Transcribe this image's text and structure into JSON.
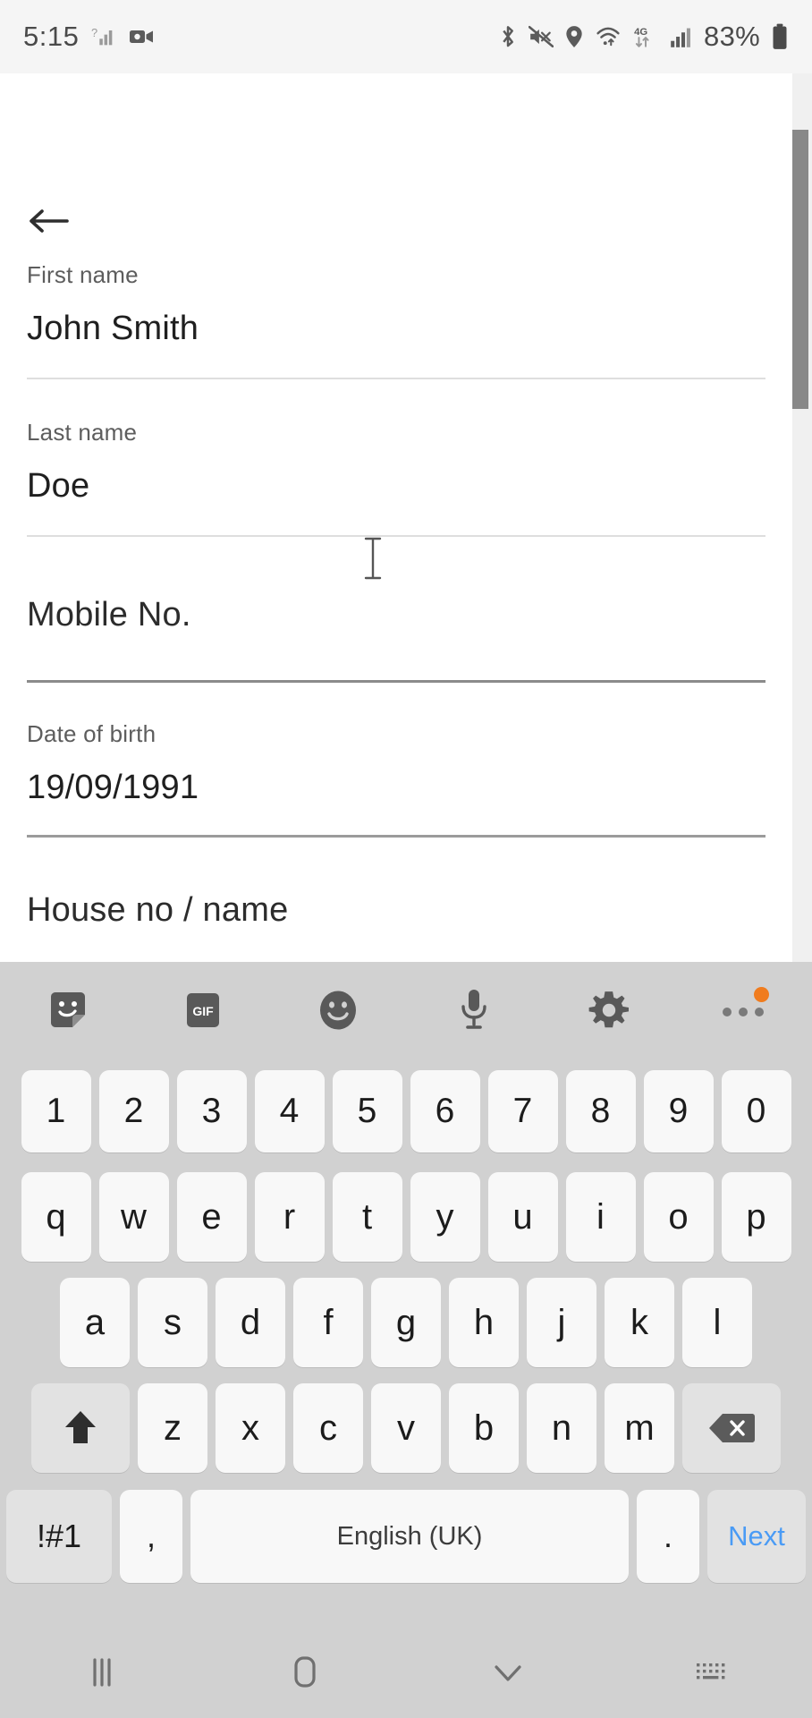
{
  "status_bar": {
    "time": "5:15",
    "battery_percent": "83%",
    "left_icons": [
      "signal-unknown-icon",
      "video-camera-icon"
    ],
    "right_icons": [
      "bluetooth-icon",
      "mute-icon",
      "location-icon",
      "wifi-icon",
      "4g-icon",
      "cellular-signal-icon"
    ],
    "network_label": "4G",
    "colors": {
      "background": "#f5f5f5",
      "foreground": "#4a4a4a"
    }
  },
  "content": {
    "back_icon": "back-arrow-icon",
    "fields": [
      {
        "label": "First name",
        "value": "John Smith",
        "placeholder": "",
        "focused": false
      },
      {
        "label": "Last name",
        "value": "Doe",
        "placeholder": "",
        "focused": false
      },
      {
        "label": "",
        "value": "",
        "placeholder": "Mobile No.",
        "focused": true
      },
      {
        "label": "Date of birth",
        "value": "19/09/1991",
        "placeholder": "",
        "focused": false
      },
      {
        "label": "",
        "value": "",
        "placeholder": "House no / name",
        "focused": false
      }
    ],
    "caret_icon": "text-cursor-icon",
    "scrollbar": {
      "name": "vertical-scrollbar",
      "thumb_color": "#888888"
    },
    "colors": {
      "background": "#ffffff",
      "label": "#5d5d5d",
      "value": "#1f1f1f",
      "rule": "#dedede",
      "rule_focused": "#8b8b8b"
    }
  },
  "keyboard": {
    "toolbar": [
      {
        "icon": "sticker-icon",
        "label": ""
      },
      {
        "icon": "gif-icon",
        "label": "GIF"
      },
      {
        "icon": "emoji-icon",
        "label": ""
      },
      {
        "icon": "microphone-icon",
        "label": ""
      },
      {
        "icon": "settings-gear-icon",
        "label": ""
      },
      {
        "icon": "more-options-icon",
        "label": "",
        "badge": true
      }
    ],
    "rows": {
      "numbers": [
        "1",
        "2",
        "3",
        "4",
        "5",
        "6",
        "7",
        "8",
        "9",
        "0"
      ],
      "top": [
        "q",
        "w",
        "e",
        "r",
        "t",
        "y",
        "u",
        "i",
        "o",
        "p"
      ],
      "home": [
        "a",
        "s",
        "d",
        "f",
        "g",
        "h",
        "j",
        "k",
        "l"
      ],
      "bottom": [
        "z",
        "x",
        "c",
        "v",
        "b",
        "n",
        "m"
      ]
    },
    "shift_icon": "shift-up-arrow-icon",
    "backspace_icon": "backspace-icon",
    "symbols_label": "!#1",
    "comma_label": ",",
    "space_label": "English (UK)",
    "period_label": ".",
    "enter_label": "Next",
    "colors": {
      "background": "#d1d1d1",
      "key": "#f8f8f8",
      "modifier_key": "#e2e2e2",
      "enter_text": "#4a9bf5",
      "badge": "#f07c1e"
    }
  },
  "nav_bar": {
    "buttons": [
      {
        "icon": "recents-icon",
        "name": "recents-button"
      },
      {
        "icon": "home-icon",
        "name": "home-button"
      },
      {
        "icon": "chevron-down-icon",
        "name": "hide-keyboard-button"
      },
      {
        "icon": "keyboard-switch-icon",
        "name": "keyboard-switch-button"
      }
    ],
    "colors": {
      "background": "#d1d1d1",
      "foreground": "#707070"
    }
  }
}
